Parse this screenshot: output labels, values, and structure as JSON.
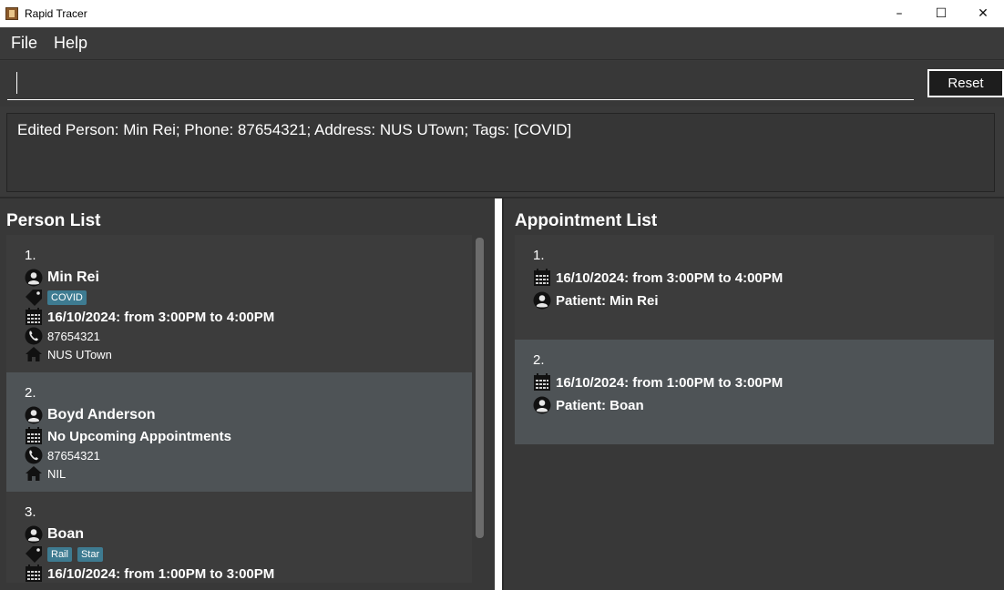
{
  "window": {
    "title": "Rapid Tracer",
    "minimize": "–",
    "maximize": "☐",
    "close": "✕"
  },
  "menu": {
    "file": "File",
    "help": "Help"
  },
  "command": {
    "value": "",
    "reset_label": "Reset"
  },
  "result": {
    "text": "Edited Person: Min Rei; Phone: 87654321; Address: NUS UTown; Tags: [COVID]"
  },
  "person_list": {
    "title": "Person List",
    "persons": [
      {
        "index": "1.",
        "name": "Min Rei",
        "tags": [
          "COVID"
        ],
        "appointment": "16/10/2024: from 3:00PM to 4:00PM",
        "phone": "87654321",
        "address": "NUS UTown"
      },
      {
        "index": "2.",
        "name": "Boyd Anderson",
        "tags": [],
        "appointment": "No Upcoming Appointments",
        "phone": "87654321",
        "address": "NIL"
      },
      {
        "index": "3.",
        "name": "Boan",
        "tags": [
          "Rail",
          "Star"
        ],
        "appointment": "16/10/2024: from 1:00PM to 3:00PM",
        "phone": "",
        "address": ""
      }
    ]
  },
  "appointment_list": {
    "title": "Appointment List",
    "appointments": [
      {
        "index": "1.",
        "time": "16/10/2024: from 3:00PM to 4:00PM",
        "patient": "Patient: Min Rei"
      },
      {
        "index": "2.",
        "time": "16/10/2024: from 1:00PM to 3:00PM",
        "patient": "Patient: Boan"
      }
    ]
  },
  "colors": {
    "background": "#3a3a3a",
    "card": "#3c3c3c",
    "card_alt": "#4e5356",
    "tag": "#3e7b91"
  },
  "icons": {
    "person": "person-icon",
    "tag": "tag-icon",
    "calendar": "calendar-icon",
    "phone": "phone-icon",
    "home": "home-icon"
  }
}
